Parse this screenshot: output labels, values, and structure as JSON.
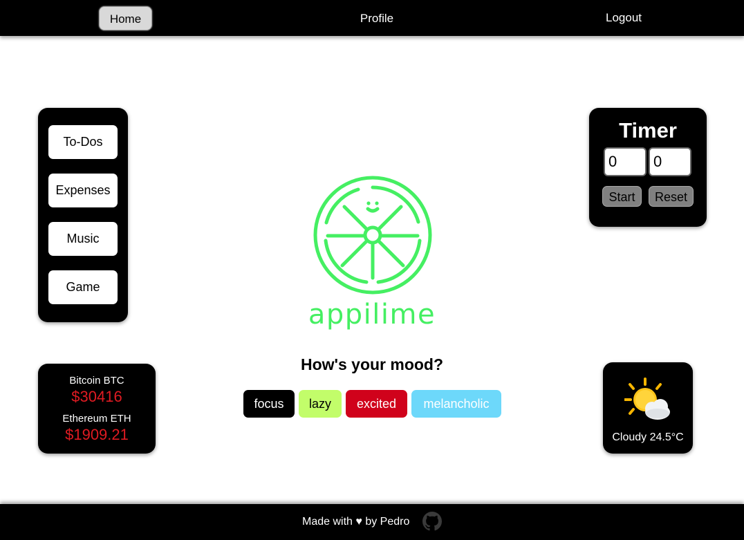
{
  "nav": {
    "home": "Home",
    "profile": "Profile",
    "logout": "Logout"
  },
  "app_menu": {
    "items": [
      {
        "label": "To-Dos"
      },
      {
        "label": "Expenses"
      },
      {
        "label": "Music"
      },
      {
        "label": "Game"
      }
    ]
  },
  "timer": {
    "title": "Timer",
    "minutes": "0",
    "seconds": "0",
    "start_label": "Start",
    "reset_label": "Reset"
  },
  "brand": {
    "name": "appilime",
    "color": "#45ef62"
  },
  "mood": {
    "title": "How's your mood?",
    "options": [
      {
        "label": "focus",
        "bg": "#000000",
        "fg": "#ffffff"
      },
      {
        "label": "lazy",
        "bg": "#c2fd6a",
        "fg": "#000000"
      },
      {
        "label": "excited",
        "bg": "#d0021b",
        "fg": "#ffffff"
      },
      {
        "label": "melancholic",
        "bg": "#6dd8fa",
        "fg": "#ffffff"
      }
    ]
  },
  "crypto": {
    "items": [
      {
        "name": "Bitcoin BTC",
        "price": "$30416"
      },
      {
        "name": "Ethereum ETH",
        "price": "$1909.21"
      }
    ],
    "price_color": "#e01b22"
  },
  "weather": {
    "icon": "sun-behind-cloud-icon",
    "text": "Cloudy 24.5°C"
  },
  "footer": {
    "text": "Made with ♥ by Pedro",
    "icon": "github-icon"
  }
}
